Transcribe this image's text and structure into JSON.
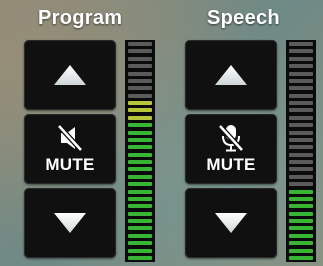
{
  "channels": {
    "program": {
      "title": "Program",
      "mute_label": "MUTE",
      "level": 0.72
    },
    "speech": {
      "title": "Speech",
      "mute_label": "MUTE",
      "level": 0.32
    }
  },
  "icons": {
    "up": "triangle-up-icon",
    "down": "triangle-down-icon",
    "program_mute": "speaker-muted-icon",
    "speech_mute": "microphone-muted-icon"
  },
  "colors": {
    "button": "#101010",
    "meter_lit_green": "#38b534",
    "meter_lit_yellow": "#b8c43a",
    "meter_off": "#5b5b5b"
  }
}
